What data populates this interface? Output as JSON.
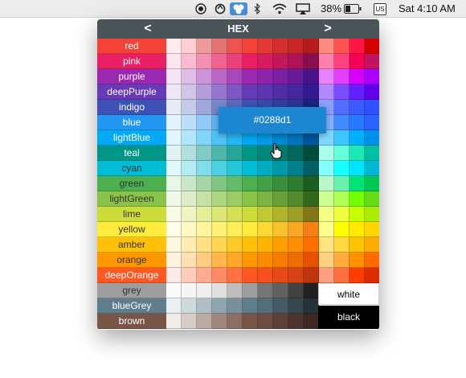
{
  "menubar": {
    "battery_text": "38%",
    "input_source": "US",
    "clock": "Sat 4:10 AM",
    "icons": [
      "screen-record-icon",
      "sync-icon",
      "palette-app-icon",
      "bluetooth-icon",
      "wifi-icon",
      "airplay-icon",
      "battery-icon",
      "input-source-icon"
    ]
  },
  "header": {
    "prev_label": "<",
    "title": "HEX",
    "next_label": ">"
  },
  "tooltip": {
    "text": "#0288d1"
  },
  "palette": [
    {
      "name": "red",
      "label_color": "#f44336",
      "text": "#ffffff",
      "shades": [
        "#ffebee",
        "#ffcdd2",
        "#ef9a9a",
        "#e57373",
        "#ef5350",
        "#f44336",
        "#e53935",
        "#d32f2f",
        "#c62828",
        "#b71c1c",
        "#ff8a80",
        "#ff5252",
        "#ff1744",
        "#d50000"
      ]
    },
    {
      "name": "pink",
      "label_color": "#e91e63",
      "text": "#ffffff",
      "shades": [
        "#fce4ec",
        "#f8bbd0",
        "#f48fb1",
        "#f06292",
        "#ec407a",
        "#e91e63",
        "#d81b60",
        "#c2185b",
        "#ad1457",
        "#880e4f",
        "#ff80ab",
        "#ff4081",
        "#f50057",
        "#c51162"
      ]
    },
    {
      "name": "purple",
      "label_color": "#9c27b0",
      "text": "#ffffff",
      "shades": [
        "#f3e5f5",
        "#e1bee7",
        "#ce93d8",
        "#ba68c8",
        "#ab47bc",
        "#9c27b0",
        "#8e24aa",
        "#7b1fa2",
        "#6a1b9a",
        "#4a148c",
        "#ea80fc",
        "#e040fb",
        "#d500f9",
        "#aa00ff"
      ]
    },
    {
      "name": "deepPurple",
      "label_color": "#673ab7",
      "text": "#ffffff",
      "shades": [
        "#ede7f6",
        "#d1c4e9",
        "#b39ddb",
        "#9575cd",
        "#7e57c2",
        "#673ab7",
        "#5e35b1",
        "#512da8",
        "#4527a0",
        "#311b92",
        "#b388ff",
        "#7c4dff",
        "#651fff",
        "#6200ea"
      ]
    },
    {
      "name": "indigo",
      "label_color": "#3f51b5",
      "text": "#ffffff",
      "shades": [
        "#e8eaf6",
        "#c5cae9",
        "#9fa8da",
        "#7986cb",
        "#5c6bc0",
        "#3f51b5",
        "#3949ab",
        "#303f9f",
        "#283593",
        "#1a237e",
        "#8c9eff",
        "#536dfe",
        "#3d5afe",
        "#304ffe"
      ]
    },
    {
      "name": "blue",
      "label_color": "#2196f3",
      "text": "#ffffff",
      "shades": [
        "#e3f2fd",
        "#bbdefb",
        "#90caf9",
        "#64b5f6",
        "#42a5f5",
        "#2196f3",
        "#1e88e5",
        "#1976d2",
        "#1565c0",
        "#0d47a1",
        "#82b1ff",
        "#448aff",
        "#2979ff",
        "#2962ff"
      ]
    },
    {
      "name": "lightBlue",
      "label_color": "#03a9f4",
      "text": "#ffffff",
      "shades": [
        "#e1f5fe",
        "#b3e5fc",
        "#81d4fa",
        "#4fc3f7",
        "#29b6f6",
        "#03a9f4",
        "#039be5",
        "#0288d1",
        "#0277bd",
        "#01579b",
        "#80d8ff",
        "#40c4ff",
        "#00b0ff",
        "#0091ea"
      ]
    },
    {
      "name": "teal",
      "label_color": "#009688",
      "text": "#ffffff",
      "shades": [
        "#e0f2f1",
        "#b2dfdb",
        "#80cbc4",
        "#4db6ac",
        "#26a69a",
        "#009688",
        "#00897b",
        "#00796b",
        "#00695c",
        "#004d40",
        "#a7ffeb",
        "#64ffda",
        "#1de9b6",
        "#00bfa5"
      ]
    },
    {
      "name": "cyan",
      "label_color": "#00bcd4",
      "text": "#333333",
      "shades": [
        "#e0f7fa",
        "#b2ebf2",
        "#80deea",
        "#4dd0e1",
        "#26c6da",
        "#00bcd4",
        "#00acc1",
        "#0097a7",
        "#00838f",
        "#006064",
        "#84ffff",
        "#18ffff",
        "#00e5ff",
        "#00b8d4"
      ]
    },
    {
      "name": "green",
      "label_color": "#4caf50",
      "text": "#333333",
      "shades": [
        "#e8f5e9",
        "#c8e6c9",
        "#a5d6a7",
        "#81c784",
        "#66bb6a",
        "#4caf50",
        "#43a047",
        "#388e3c",
        "#2e7d32",
        "#1b5e20",
        "#b9f6ca",
        "#69f0ae",
        "#00e676",
        "#00c853"
      ]
    },
    {
      "name": "lightGreen",
      "label_color": "#8bc34a",
      "text": "#333333",
      "shades": [
        "#f1f8e9",
        "#dcedc8",
        "#c5e1a5",
        "#aed581",
        "#9ccc65",
        "#8bc34a",
        "#7cb342",
        "#689f38",
        "#558b2f",
        "#33691e",
        "#ccff90",
        "#b2ff59",
        "#76ff03",
        "#64dd17"
      ]
    },
    {
      "name": "lime",
      "label_color": "#cddc39",
      "text": "#333333",
      "shades": [
        "#f9fbe7",
        "#f0f4c3",
        "#e6ee9c",
        "#dce775",
        "#d4e157",
        "#cddc39",
        "#c0ca33",
        "#afb42b",
        "#9e9d24",
        "#827717",
        "#f4ff81",
        "#eeff41",
        "#c6ff00",
        "#aeea00"
      ]
    },
    {
      "name": "yellow",
      "label_color": "#ffeb3b",
      "text": "#333333",
      "shades": [
        "#fffde7",
        "#fff9c4",
        "#fff59d",
        "#fff176",
        "#ffee58",
        "#ffeb3b",
        "#fdd835",
        "#fbc02d",
        "#f9a825",
        "#f57f17",
        "#ffff8d",
        "#ffff00",
        "#ffea00",
        "#ffd600"
      ]
    },
    {
      "name": "amber",
      "label_color": "#ffc107",
      "text": "#333333",
      "shades": [
        "#fff8e1",
        "#ffecb3",
        "#ffe082",
        "#ffd54f",
        "#ffca28",
        "#ffc107",
        "#ffb300",
        "#ffa000",
        "#ff8f00",
        "#ff6f00",
        "#ffe57f",
        "#ffd740",
        "#ffc400",
        "#ffab00"
      ]
    },
    {
      "name": "orange",
      "label_color": "#ff9800",
      "text": "#333333",
      "shades": [
        "#fff3e0",
        "#ffe0b2",
        "#ffcc80",
        "#ffb74d",
        "#ffa726",
        "#ff9800",
        "#fb8c00",
        "#f57c00",
        "#ef6c00",
        "#e65100",
        "#ffd180",
        "#ffab40",
        "#ff9100",
        "#ff6d00"
      ]
    },
    {
      "name": "deepOrange",
      "label_color": "#ff5722",
      "text": "#ffffff",
      "shades": [
        "#fbe9e7",
        "#ffccbc",
        "#ffab91",
        "#ff8a65",
        "#ff7043",
        "#ff5722",
        "#f4511e",
        "#e64a19",
        "#d84315",
        "#bf360c",
        "#ff9e80",
        "#ff6e40",
        "#ff3d00",
        "#dd2c00"
      ]
    },
    {
      "name": "grey",
      "label_color": "#9e9e9e",
      "text": "#333333",
      "shades": [
        "#fafafa",
        "#f5f5f5",
        "#eeeeee",
        "#e0e0e0",
        "#bdbdbd",
        "#9e9e9e",
        "#757575",
        "#616161",
        "#424242",
        "#212121"
      ]
    },
    {
      "name": "blueGrey",
      "label_color": "#607d8b",
      "text": "#ffffff",
      "shades": [
        "#eceff1",
        "#cfd8dc",
        "#b0bec5",
        "#90a4ae",
        "#78909c",
        "#607d8b",
        "#546e7a",
        "#455a64",
        "#37474f",
        "#263238"
      ]
    },
    {
      "name": "brown",
      "label_color": "#795548",
      "text": "#ffffff",
      "shades": [
        "#efebe9",
        "#d7ccc8",
        "#bcaaa4",
        "#a1887f",
        "#8d6e63",
        "#795548",
        "#6d4c41",
        "#5d4037",
        "#4e342e",
        "#3e2723"
      ]
    }
  ],
  "extras": {
    "white_label": "white",
    "black_label": "black",
    "white_color": "#ffffff",
    "black_color": "#000000"
  }
}
